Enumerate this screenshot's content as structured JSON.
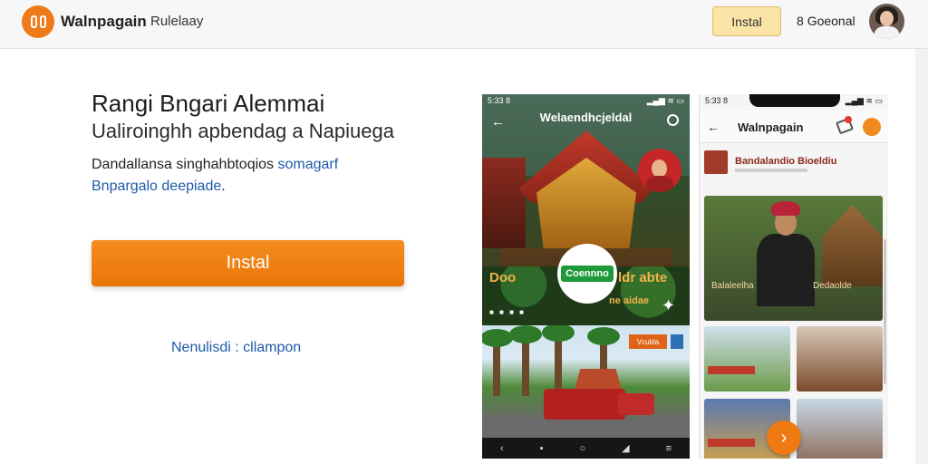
{
  "header": {
    "brand": "Walnpagain",
    "brand_sub": "Rulelaay",
    "install_label": "Instal",
    "link_label": "Goeonal",
    "link_prefix": "8"
  },
  "hero": {
    "title": "Rangi Bngari Alemmai",
    "subtitle": "Ualiroinghh apbendag a Napiuega",
    "desc_part1": "Dandallansa singhahbtoqios",
    "desc_highlight": "somagarf",
    "desc_line2_blue": "Bnpargalo deepiade",
    "desc_line2_end": ".",
    "install_button": "Instal",
    "secondary_link": "Nenulisdi : cllampon"
  },
  "phone1": {
    "status_time": "5:33 8",
    "status_right": "▂▄▆ ≋ ▭",
    "title": "Welaendhcjeldal",
    "caption_left": "Doo",
    "caption_right": "ldr abte",
    "caption_small": "ne aidae",
    "play_label": "Coennno",
    "orange_badge": "Vcubla"
  },
  "phone2": {
    "status_time": "5:33 8",
    "status_right": "▂▄▆ ≋ ▭",
    "title": "Walnpagain",
    "featured_title": "Bandalandio Bioeldiu",
    "card_label_left": "Balaleelha",
    "card_label_right": "Dedaolde",
    "tag_count": "1"
  },
  "colors": {
    "accent": "#ef7a1a",
    "link": "#1e5aa8",
    "top_install_bg": "#fbe4a8"
  }
}
